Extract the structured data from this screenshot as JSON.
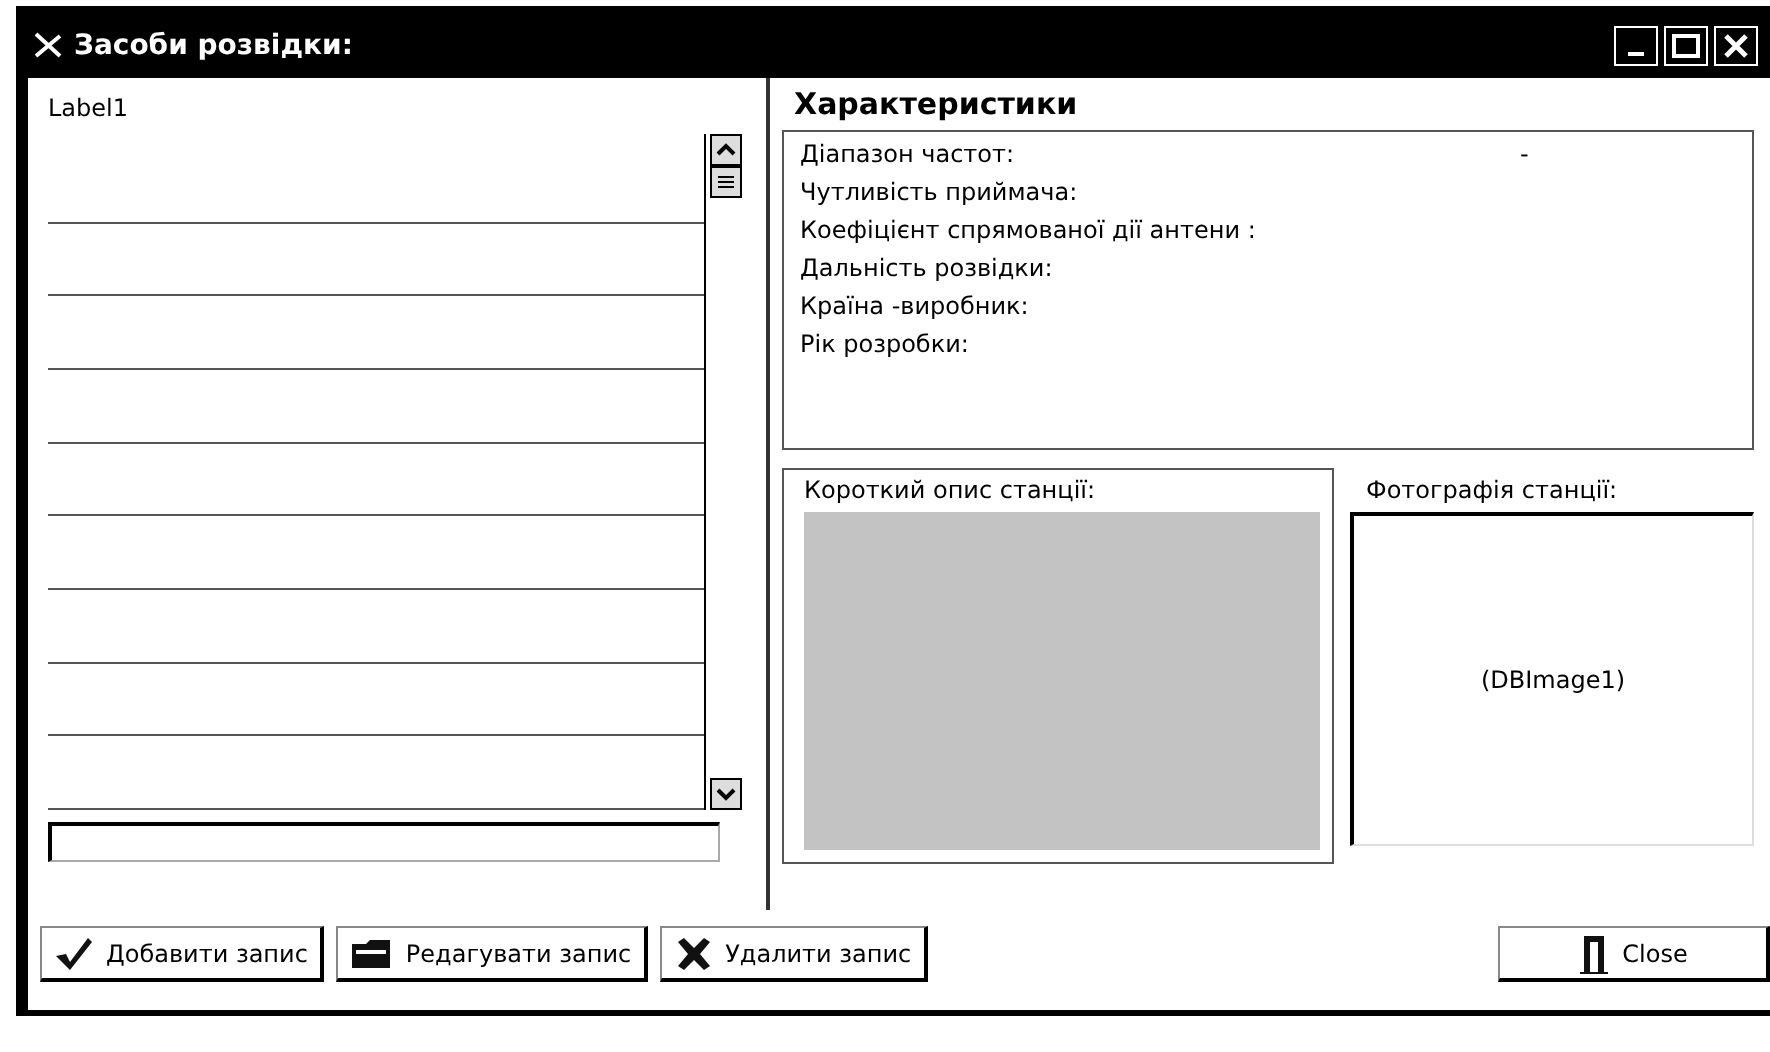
{
  "window": {
    "title": "Засоби розвідки:"
  },
  "left": {
    "label": "Label1"
  },
  "characteristics": {
    "title": "Характеристики",
    "fields": [
      {
        "label": "Діапазон частот:",
        "value": "-"
      },
      {
        "label": "Чутливість приймача:"
      },
      {
        "label": "Коефіцієнт спрямованої дії антени :"
      },
      {
        "label": "Дальність розвідки:"
      },
      {
        "label": "Країна -виробник:"
      },
      {
        "label": "Рік розробки:"
      }
    ]
  },
  "description": {
    "label": "Короткий опис станції:"
  },
  "photo": {
    "label": "Фотографія станції:",
    "placeholder": "(DBImage1)"
  },
  "buttons": [
    {
      "kind": "add",
      "label": "Добавити запис"
    },
    {
      "kind": "edit",
      "label": "Редагувати запис"
    },
    {
      "kind": "delete",
      "label": "Удалити запис"
    },
    {
      "kind": "close",
      "label": "Close"
    }
  ]
}
